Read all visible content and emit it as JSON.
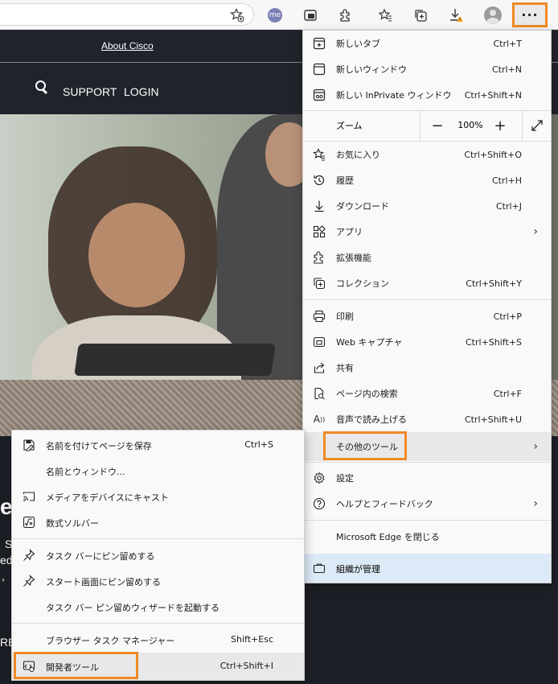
{
  "toolbar": {
    "me_badge": "me",
    "more_label": "···",
    "icons": [
      "favorite-add-icon",
      "me-extension-icon",
      "web-capture-icon",
      "extensions-icon",
      "favorites-icon",
      "collections-icon",
      "downloads-icon",
      "profile-icon"
    ]
  },
  "page": {
    "about": "About Cisco",
    "support": "SUPPORT",
    "login": "LOGIN",
    "fragments": [
      "e",
      "S",
      "ed",
      ",",
      "RE"
    ]
  },
  "menu": {
    "items": [
      {
        "label": "新しいタブ",
        "shortcut": "Ctrl+T",
        "icon": "new-tab-icon"
      },
      {
        "label": "新しいウィンドウ",
        "shortcut": "Ctrl+N",
        "icon": "new-window-icon"
      },
      {
        "label": "新しい InPrivate ウィンドウ",
        "shortcut": "Ctrl+Shift+N",
        "icon": "inprivate-icon"
      },
      {
        "label": "お気に入り",
        "shortcut": "Ctrl+Shift+O",
        "icon": "favorites-icon"
      },
      {
        "label": "履歴",
        "shortcut": "Ctrl+H",
        "icon": "history-icon"
      },
      {
        "label": "ダウンロード",
        "shortcut": "Ctrl+J",
        "icon": "download-icon"
      },
      {
        "label": "アプリ",
        "shortcut": "",
        "icon": "apps-icon"
      },
      {
        "label": "拡張機能",
        "shortcut": "",
        "icon": "extensions-icon"
      },
      {
        "label": "コレクション",
        "shortcut": "Ctrl+Shift+Y",
        "icon": "collections-icon"
      },
      {
        "label": "印刷",
        "shortcut": "Ctrl+P",
        "icon": "print-icon"
      },
      {
        "label": "Web キャプチャ",
        "shortcut": "Ctrl+Shift+S",
        "icon": "web-capture-icon"
      },
      {
        "label": "共有",
        "shortcut": "",
        "icon": "share-icon"
      },
      {
        "label": "ページ内の検索",
        "shortcut": "Ctrl+F",
        "icon": "find-icon"
      },
      {
        "label": "音声で読み上げる",
        "shortcut": "Ctrl+Shift+U",
        "icon": "read-aloud-icon"
      },
      {
        "label": "その他のツール",
        "shortcut": "",
        "icon": ""
      },
      {
        "label": "設定",
        "shortcut": "",
        "icon": "settings-icon"
      },
      {
        "label": "ヘルプとフィードバック",
        "shortcut": "",
        "icon": "help-icon"
      },
      {
        "label": "Microsoft Edge を閉じる",
        "shortcut": "",
        "icon": ""
      }
    ],
    "zoom_label": "ズーム",
    "zoom_value": "100%",
    "zoom_minus": "−",
    "zoom_plus": "+",
    "managed": "組織が管理"
  },
  "submenu": {
    "items": [
      {
        "label": "名前を付けてページを保存",
        "shortcut": "Ctrl+S",
        "icon": "save-page-icon"
      },
      {
        "label": "名前とウィンドウ...",
        "shortcut": "",
        "icon": ""
      },
      {
        "label": "メディアをデバイスにキャスト",
        "shortcut": "",
        "icon": "cast-icon"
      },
      {
        "label": "数式ソルバー",
        "shortcut": "",
        "icon": "math-solver-icon"
      },
      {
        "label": "タスク バーにピン留めする",
        "shortcut": "",
        "icon": "pin-icon"
      },
      {
        "label": "スタート画面にピン留めする",
        "shortcut": "",
        "icon": "pin-icon"
      },
      {
        "label": "タスク バー ピン留めウィザードを起動する",
        "shortcut": "",
        "icon": ""
      },
      {
        "label": "ブラウザー タスク マネージャー",
        "shortcut": "Shift+Esc",
        "icon": ""
      },
      {
        "label": "開発者ツール",
        "shortcut": "Ctrl+Shift+I",
        "icon": "developer-tools-icon"
      }
    ]
  },
  "colors": {
    "highlight_border": "#f08a24",
    "managed_bg": "#dce9f6",
    "page_dark": "#20232b"
  }
}
